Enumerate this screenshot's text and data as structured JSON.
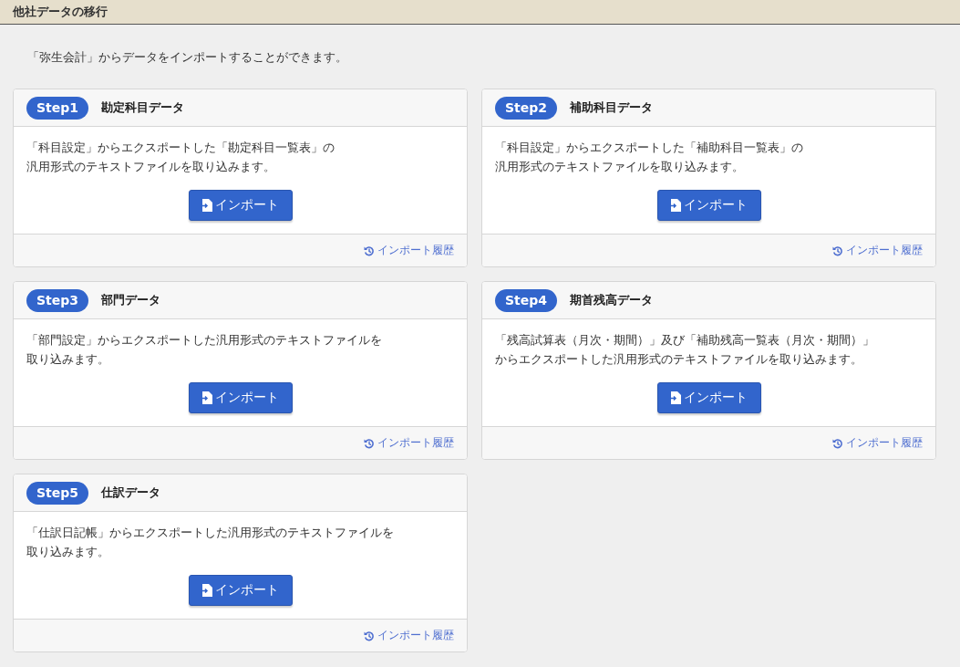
{
  "page_title": "他社データの移行",
  "intro": "「弥生会計」からデータをインポートすることができます。",
  "steps": [
    {
      "badge": "Step1",
      "title": "勘定科目データ",
      "description": [
        "「科目設定」からエクスポートした「勘定科目一覧表」の",
        "汎用形式のテキストファイルを取り込みます。"
      ],
      "button": "インポート",
      "history_link": "インポート履歴"
    },
    {
      "badge": "Step2",
      "title": "補助科目データ",
      "description": [
        "「科目設定」からエクスポートした「補助科目一覧表」の",
        "汎用形式のテキストファイルを取り込みます。"
      ],
      "button": "インポート",
      "history_link": "インポート履歴"
    },
    {
      "badge": "Step3",
      "title": "部門データ",
      "description": [
        "「部門設定」からエクスポートした汎用形式のテキストファイルを",
        "取り込みます。"
      ],
      "button": "インポート",
      "history_link": "インポート履歴"
    },
    {
      "badge": "Step4",
      "title": "期首残高データ",
      "description": [
        "「残高試算表（月次・期間）」及び「補助残高一覧表（月次・期間）」",
        "からエクスポートした汎用形式のテキストファイルを取り込みます。"
      ],
      "button": "インポート",
      "history_link": "インポート履歴"
    },
    {
      "badge": "Step5",
      "title": "仕訳データ",
      "description": [
        "「仕訳日記帳」からエクスポートした汎用形式のテキストファイルを",
        "取り込みます。"
      ],
      "button": "インポート",
      "history_link": "インポート履歴"
    }
  ]
}
